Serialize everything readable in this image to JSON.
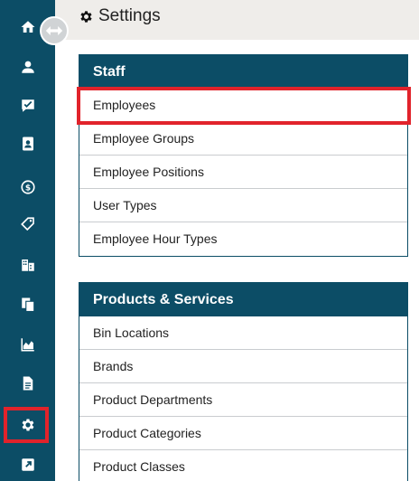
{
  "header": {
    "title": "Settings",
    "icon": "gear-icon"
  },
  "sidebar": {
    "toggle_icon": "double-arrow-icon",
    "items": [
      {
        "name": "home",
        "icon": "home-icon"
      },
      {
        "name": "customers",
        "icon": "user-icon"
      },
      {
        "name": "tasks",
        "icon": "checkbox-message-icon"
      },
      {
        "name": "contacts",
        "icon": "address-book-icon"
      },
      {
        "name": "billing",
        "icon": "dollar-icon"
      },
      {
        "name": "tags",
        "icon": "tag-icon"
      },
      {
        "name": "buildings",
        "icon": "building-icon"
      },
      {
        "name": "documents",
        "icon": "copy-icon"
      },
      {
        "name": "reports",
        "icon": "area-chart-icon"
      },
      {
        "name": "files",
        "icon": "file-icon"
      },
      {
        "name": "settings",
        "icon": "gear-icon",
        "active": true
      },
      {
        "name": "external",
        "icon": "external-link-icon"
      }
    ]
  },
  "panels": {
    "staff": {
      "title": "Staff",
      "items": [
        "Employees",
        "Employee Groups",
        "Employee Positions",
        "User Types",
        "Employee Hour Types"
      ]
    },
    "products": {
      "title": "Products & Services",
      "items": [
        "Bin Locations",
        "Brands",
        "Product Departments",
        "Product Categories",
        "Product Classes"
      ]
    }
  },
  "colors": {
    "sidebar": "#0c4d66",
    "highlight": "#e1232b",
    "header_bg": "#efedea"
  }
}
